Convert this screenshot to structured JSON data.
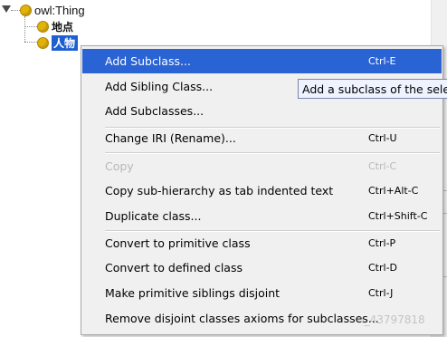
{
  "tree": {
    "root": {
      "label": "owl:Thing"
    },
    "children": [
      {
        "label": "地点",
        "selected": false
      },
      {
        "label": "人物",
        "selected": true
      }
    ]
  },
  "menu": {
    "items": [
      {
        "label": "Add Subclass...",
        "shortcut": "Ctrl-E"
      },
      {
        "label": "Add Sibling Class...",
        "shortcut": ""
      },
      {
        "label": "Add Subclasses...",
        "shortcut": ""
      },
      {
        "label": "Change IRI (Rename)...",
        "shortcut": "Ctrl-U"
      },
      {
        "label": "Copy",
        "shortcut": "Ctrl-C"
      },
      {
        "label": "Copy sub-hierarchy as tab indented text",
        "shortcut": "Ctrl+Alt-C"
      },
      {
        "label": "Duplicate class...",
        "shortcut": "Ctrl+Shift-C"
      },
      {
        "label": "Convert to primitive class",
        "shortcut": "Ctrl-P"
      },
      {
        "label": "Convert to defined class",
        "shortcut": "Ctrl-D"
      },
      {
        "label": "Make primitive siblings disjoint",
        "shortcut": "Ctrl-J"
      },
      {
        "label": "Remove disjoint classes axioms for subclasses...",
        "shortcut": ""
      }
    ]
  },
  "tooltip": {
    "text": "Add a subclass of the selec"
  },
  "watermark": {
    "text": "n_43797818"
  },
  "colors": {
    "highlight": "#2a63d4",
    "selection": "#1f5fd1",
    "class_icon": "#e0b20a"
  }
}
